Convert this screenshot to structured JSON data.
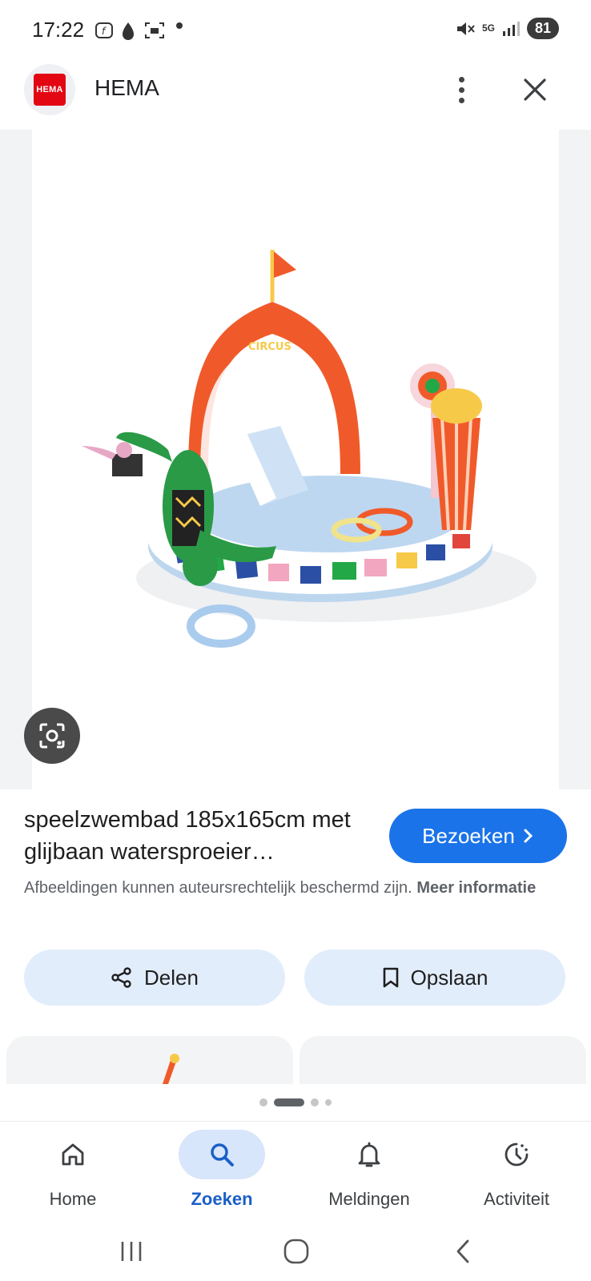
{
  "status_bar": {
    "time": "17:22",
    "battery": "81",
    "network": "5G"
  },
  "app_bar": {
    "logo_text": "HEMA",
    "site_name": "HEMA"
  },
  "result": {
    "title": "speelzwembad 185x165cm met glijbaan watersproeier…",
    "visit_label": "Bezoeken",
    "copyright_text": "Afbeeldingen kunnen auteursrechtelijk beschermd zijn.",
    "more_info_label": "Meer informatie",
    "image_text": "CIRCUS"
  },
  "actions": {
    "share_label": "Delen",
    "save_label": "Opslaan"
  },
  "bottom_nav": {
    "items": [
      {
        "label": "Home",
        "icon": "home-icon"
      },
      {
        "label": "Zoeken",
        "icon": "search-icon"
      },
      {
        "label": "Meldingen",
        "icon": "bell-icon"
      },
      {
        "label": "Activiteit",
        "icon": "activity-icon"
      }
    ],
    "active": "Zoeken"
  },
  "colors": {
    "accent": "#1a73e8",
    "tonal_button": "#e2edfc",
    "brand_red": "#e30613"
  }
}
